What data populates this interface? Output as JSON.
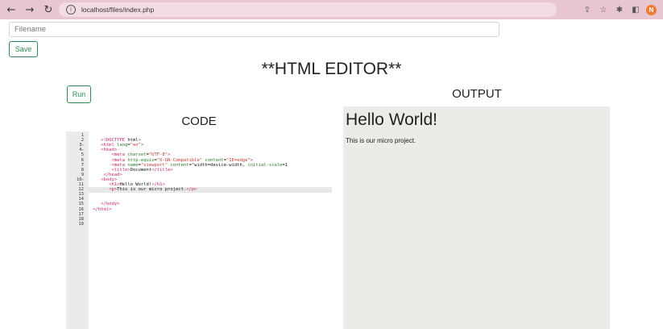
{
  "browser": {
    "url": "localhost/files/index.php",
    "profile_initial": "N",
    "icons": [
      "back-icon",
      "forward-icon",
      "reload-icon",
      "info-icon",
      "share-icon",
      "star-icon",
      "extensions-icon",
      "sidebar-icon",
      "profile-avatar"
    ]
  },
  "toolbar": {
    "filename_placeholder": "Filename",
    "save_label": "Save"
  },
  "page": {
    "title": "**HTML EDITOR**",
    "run_label": "Run",
    "output_heading": "OUTPUT",
    "code_heading": "CODE"
  },
  "editor": {
    "line_numbers": [
      "1",
      "2",
      "3",
      "4",
      "5",
      "6",
      "7",
      "8",
      "9",
      "10",
      "11",
      "12",
      "13",
      "14",
      "15",
      "16",
      "17",
      "18",
      "19"
    ],
    "fold_markers": [
      "",
      "",
      "▾",
      "▾",
      "",
      "",
      "",
      "",
      "",
      "▾",
      "",
      "",
      "",
      "",
      "",
      "",
      "",
      "",
      ""
    ],
    "active_line": 12,
    "lines": [
      "",
      "    <!DOCTYPE html>",
      "    <html lang=\"en\">",
      "    <head>",
      "        <meta charset=\"UTF-8\">",
      "        <meta http-equiv=\"X-UA-Compatible\" content=\"IE=edge\">",
      "        <meta name=\"viewport\" content=\"width=device-width, initial-scale=1",
      "        <title>Document</title>",
      "     </head>",
      "    <body>",
      "       <h1>Hello World!</h1>",
      "       <p>This is our micro project.</p>",
      "",
      "",
      "    </body>",
      " </html>",
      "",
      "",
      ""
    ]
  },
  "output": {
    "heading": "Hello World!",
    "paragraph": "This is our micro project."
  },
  "colors": {
    "chrome_bg": "#e8c6cf",
    "button_green": "#2e8b57",
    "output_bg": "#ebebe7",
    "tag_color": "#c9246a",
    "attr_color": "#2b7d2b",
    "string_color": "#c0392b"
  }
}
